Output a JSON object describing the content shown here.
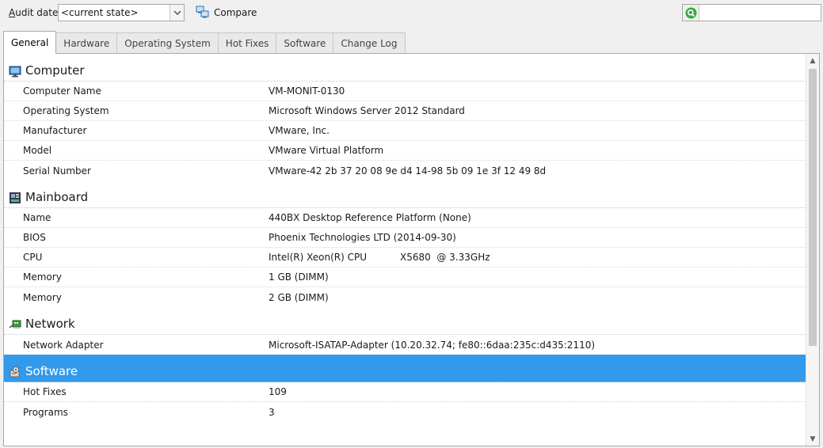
{
  "toolbar": {
    "audit_label_prefix": "A",
    "audit_label_rest": "udit date:",
    "audit_value": "<current state>",
    "compare_label": "Compare",
    "search_placeholder": ""
  },
  "tabs": [
    {
      "label": "General",
      "active": true
    },
    {
      "label": "Hardware"
    },
    {
      "label": "Operating System"
    },
    {
      "label": "Hot Fixes"
    },
    {
      "label": "Software"
    },
    {
      "label": "Change Log"
    }
  ],
  "sections": {
    "computer": {
      "title": "Computer",
      "icon": "monitor-icon",
      "rows": [
        {
          "name": "Computer Name",
          "value": "VM-MONIT-0130"
        },
        {
          "name": "Operating System",
          "value": "Microsoft Windows Server 2012 Standard"
        },
        {
          "name": "Manufacturer",
          "value": "VMware, Inc."
        },
        {
          "name": "Model",
          "value": "VMware Virtual Platform"
        },
        {
          "name": "Serial Number",
          "value": "VMware-42 2b 37 20 08 9e d4 14-98 5b 09 1e 3f 12 49 8d"
        }
      ]
    },
    "mainboard": {
      "title": "Mainboard",
      "icon": "chip-icon",
      "rows": [
        {
          "name": "Name",
          "value": "440BX Desktop Reference Platform (None)"
        },
        {
          "name": "BIOS",
          "value": "Phoenix Technologies LTD (2014-09-30)"
        },
        {
          "name": "CPU",
          "value": "Intel(R) Xeon(R) CPU           X5680  @ 3.33GHz"
        },
        {
          "name": "Memory",
          "value": "1 GB (DIMM)"
        },
        {
          "name": "Memory",
          "value": "2 GB (DIMM)"
        }
      ]
    },
    "network": {
      "title": "Network",
      "icon": "network-icon",
      "rows": [
        {
          "name": "Network Adapter",
          "value": "Microsoft-ISATAP-Adapter (10.20.32.74; fe80::6daa:235c:d435:2110)"
        }
      ]
    },
    "software": {
      "title": "Software",
      "icon": "software-icon",
      "rows": [
        {
          "name": "Hot Fixes",
          "value": "109"
        },
        {
          "name": "Programs",
          "value": "3"
        }
      ]
    }
  },
  "colors": {
    "selection": "#3399ea",
    "search_accent": "#3aa54a"
  }
}
